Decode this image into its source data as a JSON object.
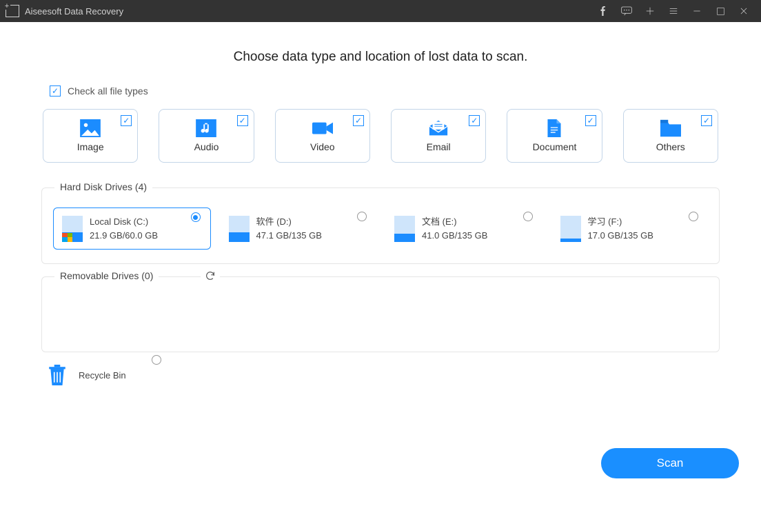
{
  "app": {
    "title": "Aiseesoft Data Recovery"
  },
  "heading": "Choose data type and location of lost data to scan.",
  "check_all_label": "Check all file types",
  "types": [
    {
      "label": "Image"
    },
    {
      "label": "Audio"
    },
    {
      "label": "Video"
    },
    {
      "label": "Email"
    },
    {
      "label": "Document"
    },
    {
      "label": "Others"
    }
  ],
  "sections": {
    "hdd": {
      "title": "Hard Disk Drives (4)"
    },
    "removable": {
      "title": "Removable Drives (0)"
    }
  },
  "drives": [
    {
      "name": "Local Disk (C:)",
      "usage": "21.9 GB/60.0 GB",
      "fill_pct": 36,
      "win": true,
      "selected": true
    },
    {
      "name": "软件 (D:)",
      "usage": "47.1 GB/135 GB",
      "fill_pct": 35,
      "win": false,
      "selected": false
    },
    {
      "name": "文档 (E:)",
      "usage": "41.0 GB/135 GB",
      "fill_pct": 30,
      "win": false,
      "selected": false
    },
    {
      "name": "学习 (F:)",
      "usage": "17.0 GB/135 GB",
      "fill_pct": 13,
      "win": false,
      "selected": false
    }
  ],
  "recycle": {
    "label": "Recycle Bin"
  },
  "scan_label": "Scan"
}
